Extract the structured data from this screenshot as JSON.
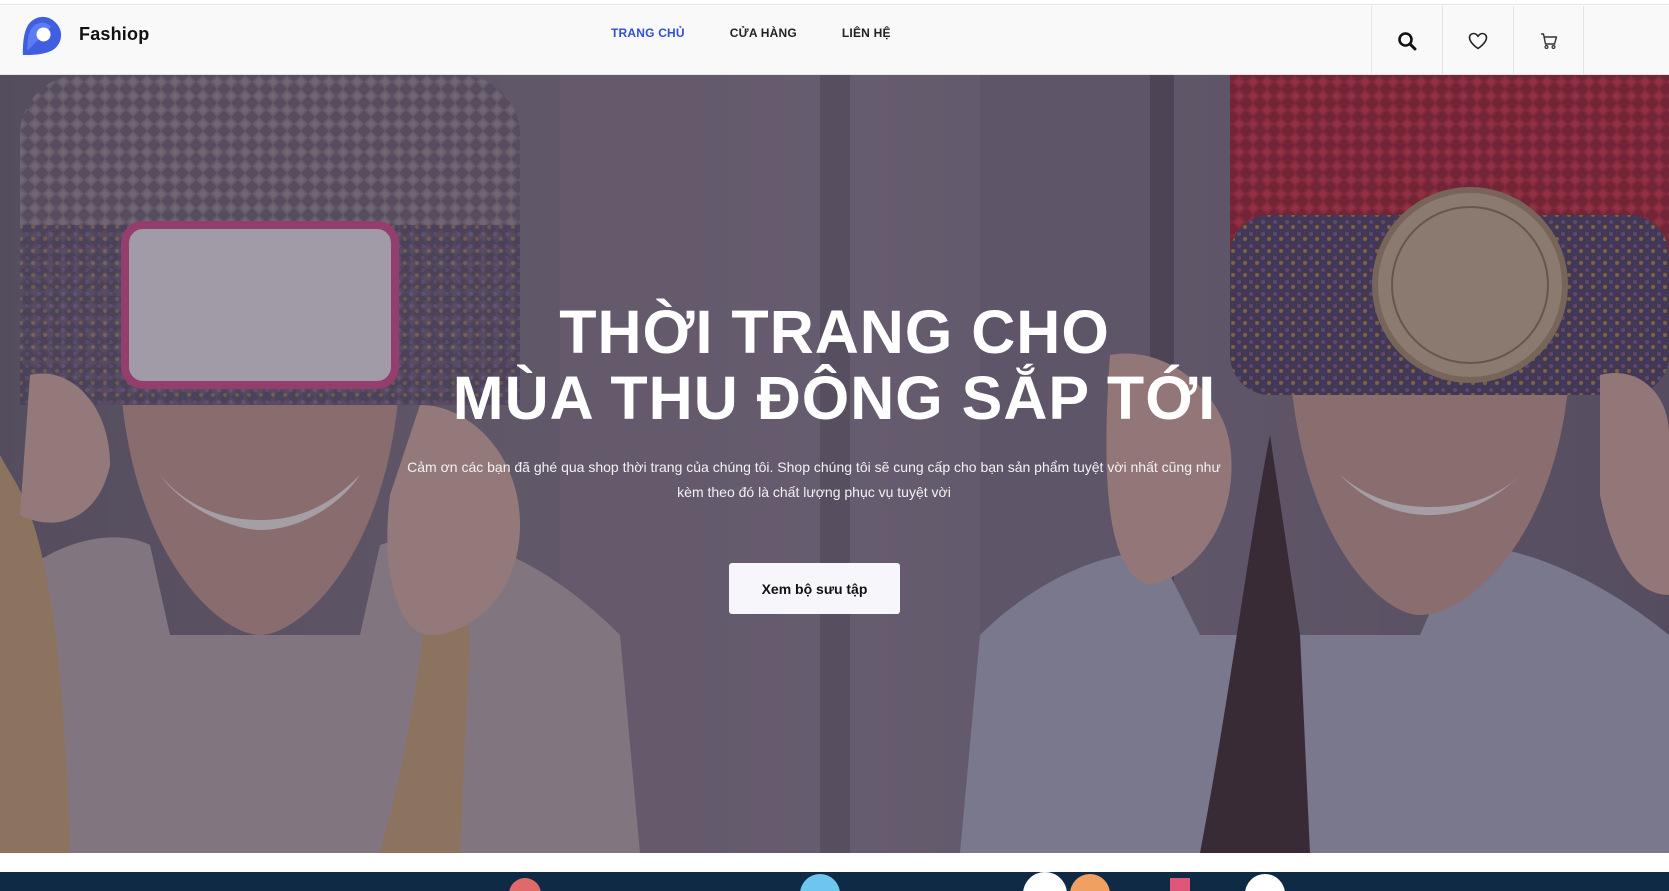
{
  "brand": {
    "name": "Fashiop",
    "logo_icon": "map-pin-logo-icon",
    "accent": "#3f5fe0"
  },
  "nav": {
    "items": [
      {
        "label": "TRANG CHỦ",
        "active": true
      },
      {
        "label": "CỬA HÀNG",
        "active": false
      },
      {
        "label": "LIÊN HỆ",
        "active": false
      }
    ],
    "active_color": "#2f4fd6"
  },
  "header_icons": [
    "search-icon",
    "heart-icon",
    "cart-icon"
  ],
  "hero": {
    "title_line1": "THỜI TRANG CHO",
    "title_line2": "MÙA THU ĐÔNG SẮP TỚI",
    "subtitle": "Cảm ơn các bạn đã ghé qua shop thời trang của chúng tôi. Shop chúng tôi sẽ cung cấp cho bạn sản phẩm tuyệt vời nhất cũng như kèm theo đó là chất lượng phục vụ tuyệt vời",
    "button_label": "Xem bộ sưu tập"
  }
}
